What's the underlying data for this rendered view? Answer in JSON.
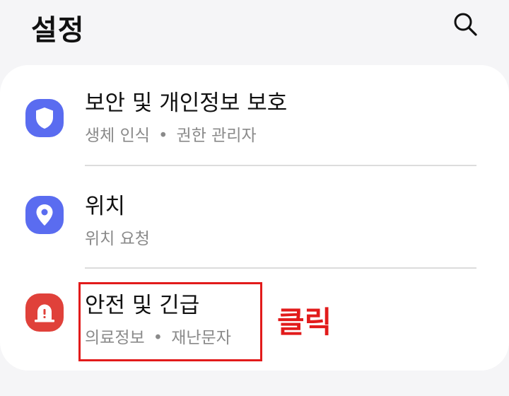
{
  "header": {
    "title": "설정",
    "search_icon": "search-icon"
  },
  "colors": {
    "background": "#f5f5f7",
    "card": "#ffffff",
    "privacy_icon_bg": "#5a6cf0",
    "location_icon_bg": "#5a6cf0",
    "safety_icon_bg": "#e0413a",
    "annotation": "#e21b1b"
  },
  "items": [
    {
      "title": "보안 및 개인정보 보호",
      "subtitle_parts": [
        "생체 인식",
        "권한 관리자"
      ],
      "icon": "shield-icon"
    },
    {
      "title": "위치",
      "subtitle_parts": [
        "위치 요청"
      ],
      "icon": "location-pin-icon"
    },
    {
      "title": "안전 및 긴급",
      "subtitle_parts": [
        "의료정보",
        "재난문자"
      ],
      "icon": "emergency-siren-icon"
    }
  ],
  "separator": "•",
  "annotation": {
    "text": "클릭"
  }
}
